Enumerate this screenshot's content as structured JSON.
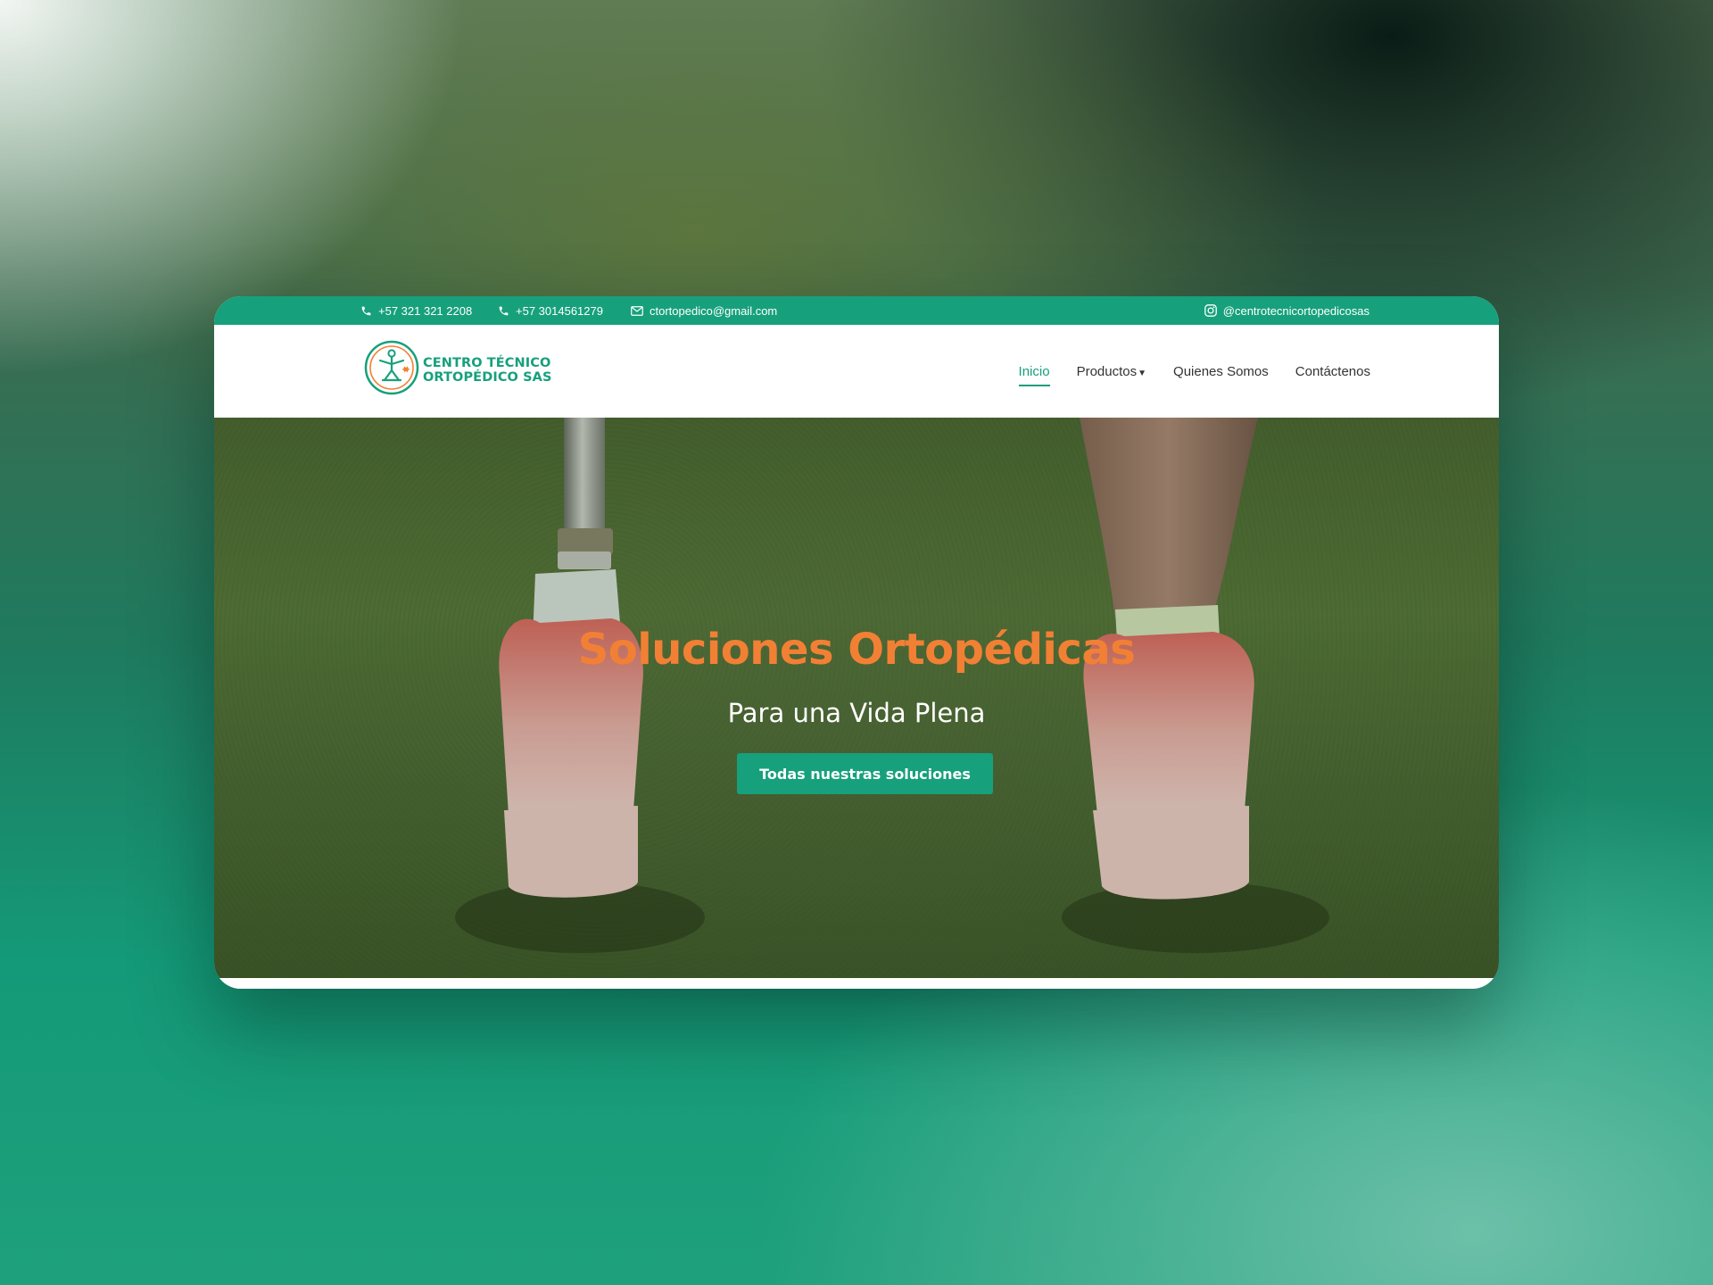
{
  "topbar": {
    "phone_1": "+57 321 321 2208",
    "phone_2": "+57 3014561279",
    "email": "ctortopedico@gmail.com",
    "instagram": "@centrotecnicortopedicosas",
    "icons": [
      "phone-icon",
      "phone-icon",
      "mail-icon",
      "instagram-icon"
    ]
  },
  "logo": {
    "line_1": "CENTRO TÉCNICO",
    "line_2": "ORTOPÉDICO SAS"
  },
  "nav": {
    "items": [
      {
        "label": "Inicio",
        "active": true
      },
      {
        "label": "Productos",
        "has_dropdown": true
      },
      {
        "label": "Quienes Somos"
      },
      {
        "label": "Contáctenos"
      }
    ]
  },
  "hero": {
    "title": "Soluciones Ortopédicas",
    "subtitle": "Para una Vida Plena",
    "button_label": "Todas nuestras soluciones"
  },
  "colors": {
    "brand_green": "#17a07c",
    "accent_orange": "#f28034",
    "nav_text": "#333333"
  }
}
